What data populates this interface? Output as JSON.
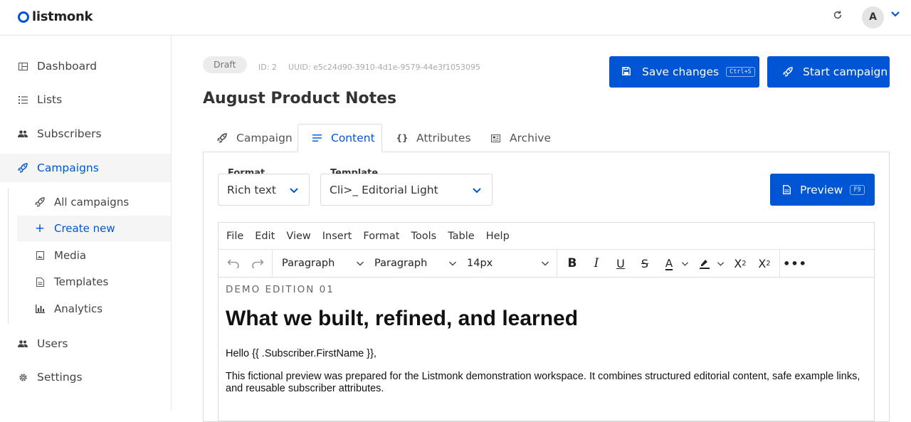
{
  "app": {
    "logo_text": "listmonk",
    "brand_color": "#0055d4",
    "avatar_initial": "A"
  },
  "header": {
    "refresh_icon": "refresh-icon",
    "avatar_chevron_icon": "chevron-down-icon"
  },
  "sidebar": {
    "items": [
      {
        "label": "Dashboard",
        "icon": "dashboard-icon"
      },
      {
        "label": "Lists",
        "icon": "list-icon"
      },
      {
        "label": "Subscribers",
        "icon": "users-icon"
      },
      {
        "label": "Campaigns",
        "icon": "rocket-icon"
      },
      {
        "label": "Users",
        "icon": "users-icon"
      },
      {
        "label": "Settings",
        "icon": "gear-icon"
      }
    ],
    "campaign_sub": [
      {
        "label": "All campaigns",
        "icon": "rocket-icon"
      },
      {
        "label": "Create new",
        "icon": "plus-icon"
      },
      {
        "label": "Media",
        "icon": "image-icon"
      },
      {
        "label": "Templates",
        "icon": "file-icon"
      },
      {
        "label": "Analytics",
        "icon": "bar-chart-icon"
      }
    ]
  },
  "campaign": {
    "status": "Draft",
    "id": "ID: 2",
    "uuid": "UUID: e5c24d90-3910-4d1e-9579-44e3f1053095",
    "title": "August Product Notes",
    "save_label": "Save changes",
    "save_shortcut": "Ctrl+S",
    "start_label": "Start campaign"
  },
  "tabs": [
    {
      "label": "Campaign",
      "icon": "rocket-icon"
    },
    {
      "label": "Content",
      "icon": "align-left-icon"
    },
    {
      "label": "Attributes",
      "icon": "braces-icon"
    },
    {
      "label": "Archive",
      "icon": "newspaper-icon"
    }
  ],
  "form": {
    "format_label": "Format",
    "format_value": "Rich text",
    "template_label": "Template",
    "template_value": "Cli>_ Editorial Light",
    "preview_label": "Preview",
    "preview_shortcut": "F9"
  },
  "editor": {
    "menus": [
      "File",
      "Edit",
      "View",
      "Insert",
      "Format",
      "Tools",
      "Table",
      "Help"
    ],
    "block_select_1": "Paragraph",
    "block_select_2": "Paragraph",
    "font_size": "14px",
    "content": {
      "eyebrow": "DEMO EDITION 01",
      "heading": "What we built, refined, and learned",
      "greeting": "Hello {{ .Subscriber.FirstName }},",
      "paragraph": "This fictional preview was prepared for the Listmonk demonstration workspace. It combines structured editorial content, safe example links, and reusable subscriber attributes."
    }
  }
}
